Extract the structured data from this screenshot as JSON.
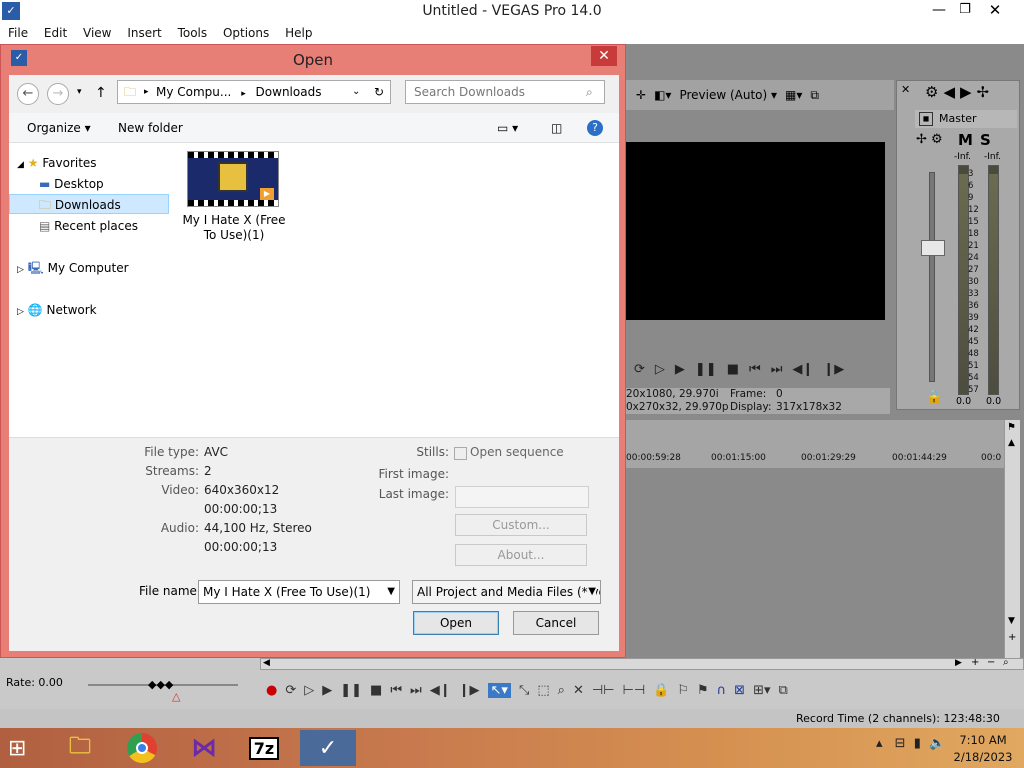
{
  "app": {
    "title": "Untitled - VEGAS Pro 14.0",
    "menu": [
      "File",
      "Edit",
      "View",
      "Insert",
      "Tools",
      "Options",
      "Help"
    ]
  },
  "preview": {
    "mode_label": "Preview (Auto)",
    "info_line1": "20x1080, 29.970i",
    "info_line2": "0x270x32, 29.970p",
    "frame_label": "Frame:",
    "frame_value": "0",
    "display_label": "Display:",
    "display_value": "317x178x32"
  },
  "mixer": {
    "master_label": "Master",
    "mute_label": "M",
    "solo_label": "S",
    "peak_left": "-Inf.",
    "peak_right": "-Inf.",
    "scale": [
      "3",
      "6",
      "9",
      "12",
      "15",
      "18",
      "21",
      "24",
      "27",
      "30",
      "33",
      "36",
      "39",
      "42",
      "45",
      "48",
      "51",
      "54",
      "57"
    ],
    "level_left": "0.0",
    "level_right": "0.0"
  },
  "timeline": {
    "ticks": [
      "00:00:59:28",
      "00:01:15:00",
      "00:01:29:29",
      "00:01:44:29",
      "00:0"
    ],
    "rate": "Rate: 0.00",
    "record_time": "Record Time (2 channels): 123:48:30"
  },
  "dialog": {
    "title": "Open",
    "address": [
      "My Compu...",
      "Downloads"
    ],
    "search_placeholder": "Search Downloads",
    "organize": "Organize",
    "new_folder": "New folder",
    "nav": {
      "favorites": "Favorites",
      "desktop": "Desktop",
      "downloads": "Downloads",
      "recent": "Recent places",
      "computer": "My Computer",
      "network": "Network"
    },
    "file": {
      "name_line1": "My I Hate X (Free",
      "name_line2": "To Use)(1)"
    },
    "details": {
      "file_type_label": "File type:",
      "file_type": "AVC",
      "streams_label": "Streams:",
      "streams": "2",
      "video_label": "Video:",
      "video_format": "640x360x12",
      "video_length": "00:00:00;13",
      "audio_label": "Audio:",
      "audio_format": "44,100 Hz, Stereo",
      "audio_length": "00:00:00;13",
      "stills_label": "Stills:",
      "open_sequence": "Open sequence",
      "first_image_label": "First image:",
      "last_image_label": "Last image:",
      "custom_button": "Custom...",
      "about_button": "About..."
    },
    "file_name_label": "File name:",
    "file_name_value": "My I Hate X (Free To Use)(1)",
    "file_type_filter": "All Project and Media Files (*.ve",
    "open_button": "Open",
    "cancel_button": "Cancel"
  },
  "taskbar": {
    "apps": [
      "file-explorer",
      "chrome",
      "visual-studio",
      "7-zip",
      "vegas-pro"
    ],
    "sevenzip_label": "7z",
    "time": "7:10 AM",
    "date": "2/18/2023"
  }
}
